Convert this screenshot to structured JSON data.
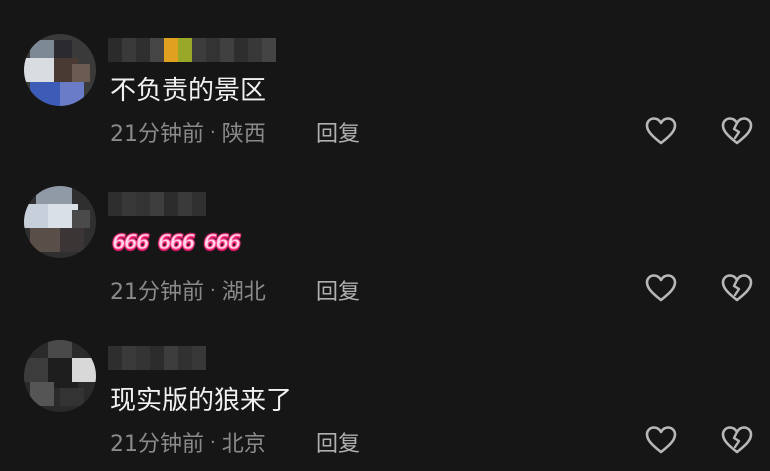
{
  "comments": [
    {
      "text": "不负责的景区",
      "time": "21分钟前",
      "location": "陕西",
      "reply_label": "回复",
      "like_icon": "heart-outline-icon",
      "dislike_icon": "broken-heart-icon"
    },
    {
      "text": "666 666 666",
      "emoji_badges": [
        "666",
        "666",
        "666"
      ],
      "time": "21分钟前",
      "location": "湖北",
      "reply_label": "回复",
      "like_icon": "heart-outline-icon",
      "dislike_icon": "broken-heart-icon"
    },
    {
      "text": "现实版的狼来了",
      "time": "21分钟前",
      "location": "北京",
      "reply_label": "回复",
      "like_icon": "heart-outline-icon",
      "dislike_icon": "broken-heart-icon"
    }
  ],
  "separator": "·",
  "colors": {
    "background": "#161616",
    "text": "#f1f1f1",
    "meta": "#8a8a8a",
    "emoji_pink": "#ff3d8b"
  }
}
